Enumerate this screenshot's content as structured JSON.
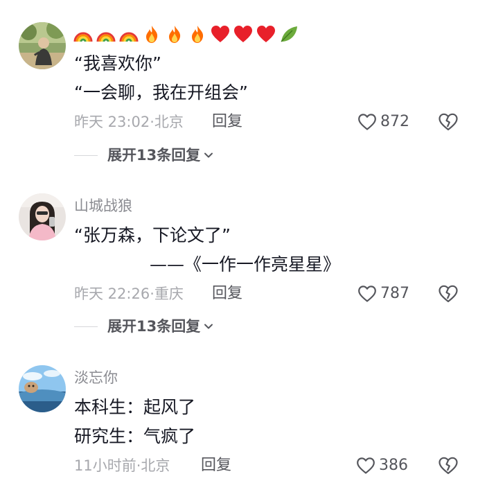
{
  "comments": [
    {
      "username": "",
      "emojis": [
        "rainbow-icon",
        "rainbow-icon",
        "rainbow-icon",
        "fire-icon",
        "fire-icon",
        "fire-icon",
        "red-heart-icon",
        "red-heart-icon",
        "red-heart-icon",
        "leaf-icon"
      ],
      "lines": [
        "“我喜欢你”",
        "“一会聊，我在开组会”"
      ],
      "time": "昨天 23:02",
      "location": "北京",
      "reply_label": "回复",
      "likes": "872",
      "expand_label": "展开13条回复"
    },
    {
      "username": "山城战狼",
      "lines": [
        "“张万森，下论文了”",
        "——《一作一作亮星星》"
      ],
      "time": "昨天 22:26",
      "location": "重庆",
      "reply_label": "回复",
      "likes": "787",
      "expand_label": "展开13条回复"
    },
    {
      "username": "淡忘你",
      "lines": [
        "本科生：起风了",
        "研究生：气疯了"
      ],
      "time": "11小时前",
      "location": "北京",
      "reply_label": "回复",
      "likes": "386"
    }
  ],
  "colors": {
    "text": "#161823",
    "secondary": "#a7a8ad",
    "username": "#8a8b91",
    "action": "#55565c"
  }
}
